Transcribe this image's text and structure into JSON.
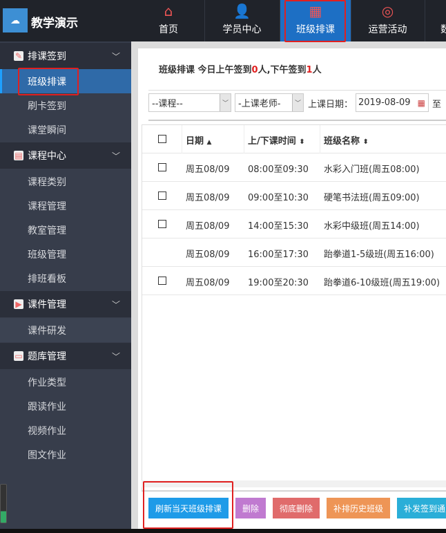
{
  "brand": {
    "name": "教学演示",
    "logo_text": "☁"
  },
  "nav": [
    {
      "label": "首页",
      "icon": "home-icon"
    },
    {
      "label": "学员中心",
      "icon": "user-gear-icon"
    },
    {
      "label": "班级排课",
      "icon": "calendar-icon",
      "active": true
    },
    {
      "label": "运营活动",
      "icon": "lifebuoy-icon"
    },
    {
      "label": "数",
      "icon": "data-icon"
    }
  ],
  "sidebar": {
    "groups": [
      {
        "label": "排课签到",
        "items": [
          "班级排课",
          "刷卡签到",
          "课堂瞬间"
        ]
      },
      {
        "label": "课程中心",
        "items": [
          "课程类别",
          "课程管理",
          "教室管理",
          "班级管理",
          "排班看板"
        ]
      },
      {
        "label": "课件管理",
        "items": [
          "课件研发"
        ]
      },
      {
        "label": "题库管理",
        "items": [
          "作业类型",
          "跟读作业",
          "视频作业",
          "图文作业"
        ]
      }
    ],
    "active": "班级排课"
  },
  "main": {
    "title_prefix": "班级排课 今日上午签到",
    "am_count": "0",
    "mid": "人,下午签到",
    "pm_count": "1",
    "suffix": "人",
    "filters": {
      "course": "--课程--",
      "teacher": "-上课老师-",
      "date_label": "上课日期：",
      "date_value": "2019-08-09",
      "to": "至"
    },
    "columns": [
      "日期",
      "上/下课时间",
      "班级名称"
    ],
    "sort_icons": [
      "▲",
      "⬍",
      "⬍"
    ],
    "rows": [
      {
        "checkbox": true,
        "date": "周五08/09",
        "time": "08:00至09:30",
        "class": "水彩入门班(周五08:00)"
      },
      {
        "checkbox": true,
        "date": "周五08/09",
        "time": "09:00至10:30",
        "class": "硬笔书法班(周五09:00)"
      },
      {
        "checkbox": true,
        "date": "周五08/09",
        "time": "14:00至15:30",
        "class": "水彩中级班(周五14:00)"
      },
      {
        "checkbox": false,
        "date": "周五08/09",
        "time": "16:00至17:30",
        "class": "跆拳道1-5级班(周五16:00)"
      },
      {
        "checkbox": true,
        "date": "周五08/09",
        "time": "19:00至20:30",
        "class": "跆拳道6-10级班(周五19:00)"
      }
    ],
    "buttons": [
      {
        "label": "刷新当天班级排课",
        "color": "#1e9be8"
      },
      {
        "label": "删除",
        "color": "#c07ad0"
      },
      {
        "label": "彻底删除",
        "color": "#e06b6b"
      },
      {
        "label": "补排历史班级",
        "color": "#ee9556"
      },
      {
        "label": "补发签到通",
        "color": "#2aaed8"
      }
    ]
  }
}
